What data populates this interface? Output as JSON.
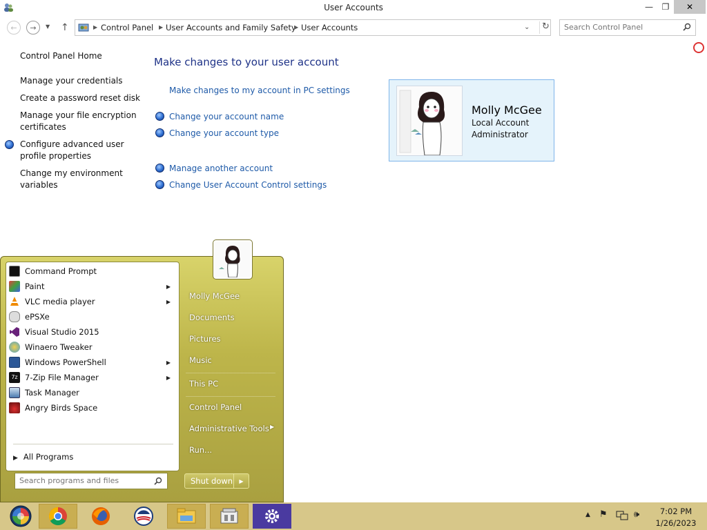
{
  "window": {
    "title": "User Accounts",
    "app_icon": "user-accounts-icon",
    "controls": {
      "minimize": "—",
      "maximize": "❐",
      "close": "✕"
    }
  },
  "navigation": {
    "breadcrumbs": [
      "Control Panel",
      "User Accounts and Family Safety",
      "User Accounts"
    ],
    "search_placeholder": "Search Control Panel"
  },
  "left_pane": {
    "links": [
      {
        "label": "Control Panel Home",
        "shield": false
      },
      {
        "label": "Manage your credentials",
        "shield": false
      },
      {
        "label": "Create a password reset disk",
        "shield": false
      },
      {
        "label": "Manage your file encryption certificates",
        "shield": false
      },
      {
        "label": "Configure advanced user profile properties",
        "shield": true
      },
      {
        "label": "Change my environment variables",
        "shield": false
      }
    ]
  },
  "main": {
    "heading": "Make changes to your user account",
    "pc_settings_link": "Make changes to my account in PC settings",
    "tasks": [
      {
        "label": "Change your account name",
        "shield": true
      },
      {
        "label": "Change your account type",
        "shield": true
      },
      {
        "label": "Manage another account",
        "shield": true
      },
      {
        "label": "Change User Account Control settings",
        "shield": true
      }
    ],
    "account": {
      "name": "Molly McGee",
      "type": "Local Account",
      "role": "Administrator"
    }
  },
  "start_menu": {
    "programs": [
      {
        "label": "Command Prompt",
        "icon": "command-prompt-icon",
        "submenu": false,
        "color": "#1a1a1a"
      },
      {
        "label": "Paint",
        "icon": "paint-icon",
        "submenu": true,
        "color": "#3a8a3a"
      },
      {
        "label": "VLC media player",
        "icon": "vlc-icon",
        "submenu": true,
        "color": "#f08a00"
      },
      {
        "label": "ePSXe",
        "icon": "epsxe-icon",
        "submenu": false,
        "color": "#8a8a8a"
      },
      {
        "label": "Visual Studio 2015",
        "icon": "visual-studio-icon",
        "submenu": false,
        "color": "#68217a"
      },
      {
        "label": "Winaero Tweaker",
        "icon": "winaero-tweaker-icon",
        "submenu": false,
        "color": "#4aa0c8"
      },
      {
        "label": "Windows PowerShell",
        "icon": "powershell-icon",
        "submenu": true,
        "color": "#2b5797"
      },
      {
        "label": "7-Zip File Manager",
        "icon": "seven-zip-icon",
        "submenu": true,
        "color": "#111111"
      },
      {
        "label": "Task Manager",
        "icon": "task-manager-icon",
        "submenu": false,
        "color": "#4a7ab0"
      },
      {
        "label": "Angry Birds Space",
        "icon": "angry-birds-icon",
        "submenu": false,
        "color": "#c02020"
      }
    ],
    "all_programs": "All Programs",
    "search_placeholder": "Search programs and files",
    "right_links": [
      "Molly McGee",
      "Documents",
      "Pictures",
      "Music",
      "This PC",
      "Control Panel",
      "Administrative Tools",
      "Run..."
    ],
    "admin_tools_has_submenu": true,
    "shutdown_label": "Shut down"
  },
  "taskbar": {
    "apps": [
      {
        "name": "start-orb",
        "icon": "start-orb-icon"
      },
      {
        "name": "chrome",
        "icon": "chrome-icon"
      },
      {
        "name": "firefox",
        "icon": "firefox-icon"
      },
      {
        "name": "obama-app",
        "icon": "campaign-logo-icon"
      },
      {
        "name": "file-explorer",
        "icon": "file-explorer-icon"
      },
      {
        "name": "control-panel",
        "icon": "control-panel-icon"
      },
      {
        "name": "settings",
        "icon": "gear-icon"
      }
    ],
    "clock": {
      "time": "7:02 PM",
      "date": "1/26/2023"
    }
  },
  "colors": {
    "link_blue": "#1e5aa8",
    "heading_blue": "#1e3287",
    "start_menu": "#bdb54a",
    "taskbar": "#d7c789",
    "account_card": "#e5f3fb"
  }
}
